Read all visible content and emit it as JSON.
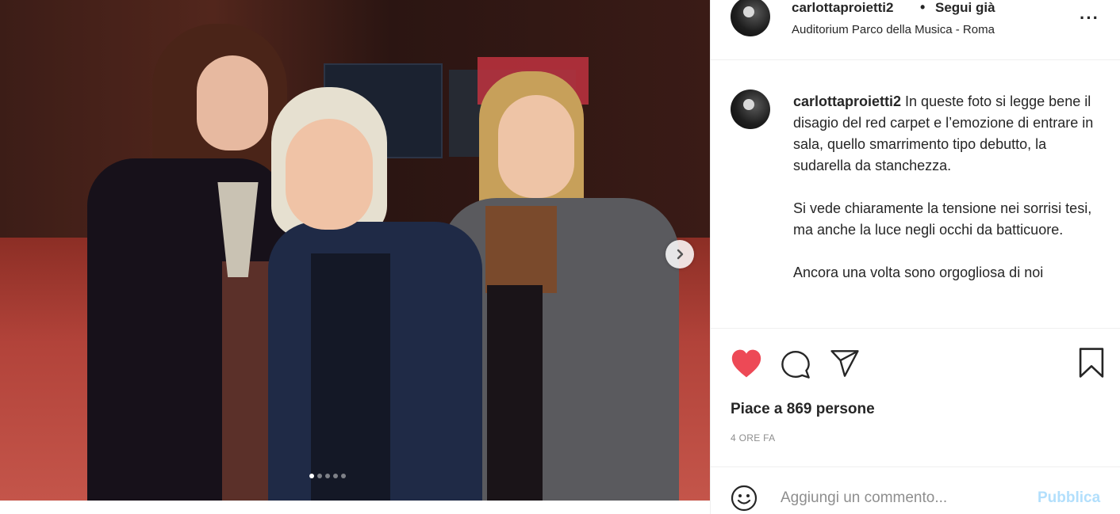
{
  "post": {
    "username": "carlottaproietti2",
    "separator": "•",
    "follow_status": "Segui già",
    "location": "Auditorium Parco della Musica - Roma",
    "more": "···",
    "caption_user": "carlottaproietti2",
    "caption_paragraphs": [
      "In queste foto si legge bene il disagio del red carpet e l’emozione di entrare in sala, quello smarrimento tipo debutto, la sudarella da stanchezza.",
      "Si vede chiaramente la tensione nei sorrisi tesi, ma anche la luce negli occhi da batticuore.",
      "Ancora una volta sono orgogliosa di noi"
    ],
    "likes_text": "Piace a 869 persone",
    "time": "4 ORE FA",
    "liked": true,
    "carousel": {
      "count": 5,
      "active_index": 0
    }
  },
  "comment_bar": {
    "placeholder": "Aggiungi un commento...",
    "publish_label": "Pubblica"
  },
  "colors": {
    "heart": "#ed4956",
    "publish_disabled": "#b2dffc",
    "text": "#262626",
    "muted": "#8e8e8e",
    "border": "#efefef"
  },
  "icons": [
    "chevron-right-icon",
    "heart-icon",
    "comment-icon",
    "share-icon",
    "bookmark-icon",
    "emoji-icon",
    "more-icon"
  ]
}
